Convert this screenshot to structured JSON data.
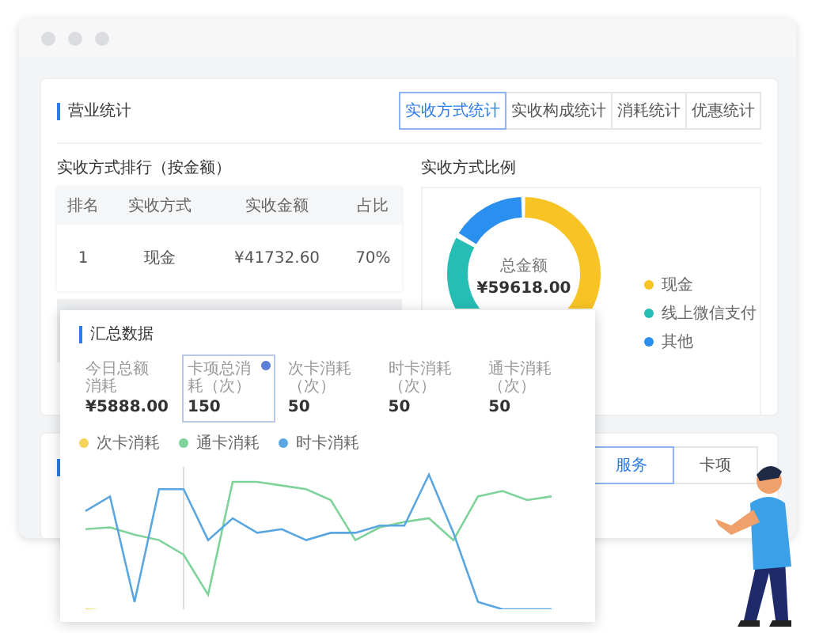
{
  "sales_panel": {
    "title": "营业统计",
    "tabs": [
      {
        "label": "实收方式统计",
        "selected": true
      },
      {
        "label": "实收构成统计",
        "selected": false
      },
      {
        "label": "消耗统计",
        "selected": false
      },
      {
        "label": "优惠统计",
        "selected": false
      }
    ]
  },
  "ranking": {
    "title": "实收方式排行（按金额）",
    "columns": [
      "排名",
      "实收方式",
      "实收金额",
      "占比"
    ],
    "rows": [
      [
        "1",
        "现金",
        "¥41732.60",
        "70%"
      ]
    ]
  },
  "ratio": {
    "title": "实收方式比例",
    "center_label": "总金额",
    "center_value": "¥59618.00",
    "legend": [
      {
        "label": "现金",
        "color": "#f7c325"
      },
      {
        "label": "线上微信支付",
        "color": "#26bdb5"
      },
      {
        "label": "其他",
        "color": "#2b8ff0"
      }
    ]
  },
  "second_panel": {
    "tabs": [
      {
        "label": "服务",
        "selected": true
      },
      {
        "label": "卡项",
        "selected": false
      }
    ]
  },
  "summary": {
    "title": "汇总数据",
    "stats": [
      {
        "label": "今日总额消耗",
        "value": "¥5888.00",
        "selected": false,
        "info": false
      },
      {
        "label": "卡项总消耗（次）",
        "value": "150",
        "selected": true,
        "info": true
      },
      {
        "label": "次卡消耗（次）",
        "value": "50",
        "selected": false,
        "info": false
      },
      {
        "label": "时卡消耗（次）",
        "value": "50",
        "selected": false,
        "info": false
      },
      {
        "label": "通卡消耗（次）",
        "value": "50",
        "selected": false,
        "info": false
      }
    ],
    "legend": [
      {
        "label": "次卡消耗",
        "color": "#f7d35a"
      },
      {
        "label": "通卡消耗",
        "color": "#7fd39a"
      },
      {
        "label": "时卡消耗",
        "color": "#5aa6e0"
      }
    ]
  }
}
